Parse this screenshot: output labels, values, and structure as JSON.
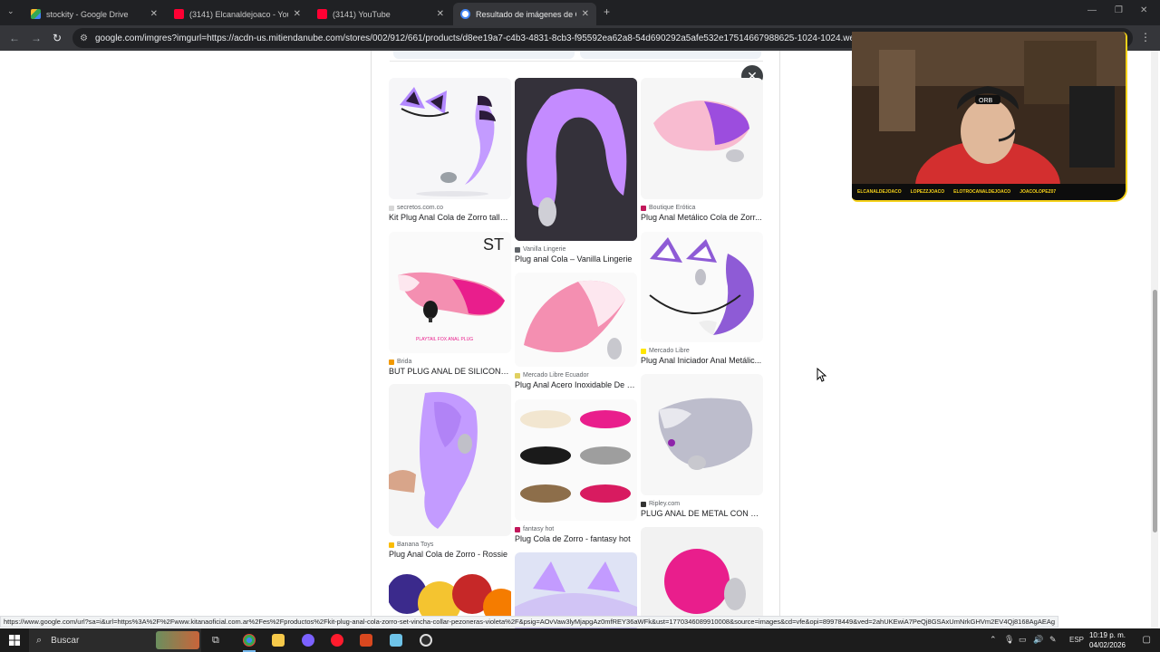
{
  "tabs": [
    {
      "title": "stockity - Google Drive",
      "icon": "google-drive-icon",
      "color": "#f9bb2d"
    },
    {
      "title": "(3141) Elcanaldejoaco - YouTube",
      "icon": "youtube-icon",
      "color": "#ff0033"
    },
    {
      "title": "(3141) YouTube",
      "icon": "youtube-icon",
      "color": "#ff0033"
    },
    {
      "title": "Resultado de imágenes de Google",
      "icon": "google-icon",
      "color": "#4285f4"
    }
  ],
  "new_tab": "+",
  "address": {
    "url": "google.com/imgres?imgurl=https://acdn-us.mitiendanube.com/stores/002/912/661/products/d8ee19a7-c4b3-4831-8cb3-f95592ea62a8-54d690292a5afe532e17514667988625-1024-1024.webp&tbnid=B"
  },
  "results": [
    {
      "source": "secretos.com.co",
      "caption": "Kit Plug Anal Cola de Zorro talla...",
      "dot": "#d7d7d7"
    },
    {
      "source": "Brida",
      "caption": "BUT PLUG ANAL DE SILICONA...",
      "dot": "#f29900",
      "overlay": "ST",
      "subtext": "PLAYTAIL FOX ANAL PLUG"
    },
    {
      "source": "Banana Toys",
      "caption": "Plug Anal Cola de Zorro - Rossie",
      "dot": "#fbbc04"
    },
    {
      "source": "Vanilla Lingerie",
      "caption": "Plug anal Cola – Vanilla Lingerie",
      "dot": "#5f6368"
    },
    {
      "source": "Mercado Libre Ecuador",
      "caption": "Plug Anal Acero Inoxidable De Z...",
      "dot": "#e0d060"
    },
    {
      "source": "fantasy hot",
      "caption": "Plug Cola de Zorro - fantasy hot",
      "dot": "#c2185b"
    },
    {
      "source": "Boutique Erótica",
      "caption": "Plug Anal Metálico Cola de Zorr...",
      "dot": "#c2185b"
    },
    {
      "source": "Mercado Libre",
      "caption": "Plug Anal Iniciador Anal Metálic...",
      "dot": "#ffe600"
    },
    {
      "source": "Ripley.com",
      "caption": "PLUG ANAL DE METAL CON C...",
      "dot": "#333333"
    }
  ],
  "close_label": "✕",
  "stream_overlay": {
    "handles": [
      "ELCANALDEJOACO",
      "LOPEZZJOACO",
      "ELOTROCANALDEJOACO",
      "JOACOLOPEZ07"
    ],
    "headset_brand": "ORB"
  },
  "status_url": "https://www.google.com/url?sa=i&url=https%3A%2F%2Fwww.kitanaoficial.com.ar%2Fes%2Fproductos%2Fkit-plug-anal-cola-zorro-set-vincha-collar-pezoneras-violeta%2F&psig=AOvVaw3lyMjapgAz0mfREY36aWFk&ust=1770346089910008&source=images&cd=vfe&opi=89978449&ved=2ahUKEwiA7PeQj8GSAxUmNrkGHVm2EV4Qj8168AgAEAg",
  "taskbar": {
    "search_placeholder": "Buscar",
    "language": "ESP",
    "time": "10:19 p. m.",
    "date": "04/02/2026"
  }
}
